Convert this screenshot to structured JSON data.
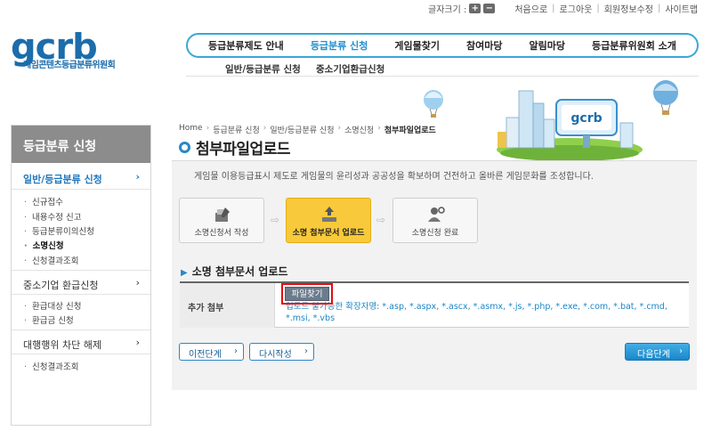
{
  "util": {
    "font_size_label": "글자크기 :",
    "zoom_in": "+",
    "zoom_out": "−",
    "links": [
      "처음으로",
      "로그아웃",
      "회원정보수정",
      "사이트맵"
    ]
  },
  "logo": {
    "text": "gcrb",
    "subtitle": "게임콘텐츠등급분류위원회"
  },
  "gnb": {
    "items": [
      "등급분류제도 안내",
      "등급분류 신청",
      "게임물찾기",
      "참여마당",
      "알림마당",
      "등급분류위원회 소개"
    ],
    "active_index": 1,
    "sub_items": [
      "일반/등급분류 신청",
      "중소기업환급신청"
    ]
  },
  "lnb": {
    "title": "등급분류 신청",
    "groups": [
      {
        "label": "일반/등급분류 신청",
        "arrow": "›",
        "items": [
          "신규접수",
          "내용수정 신고",
          "등급분류이의신청",
          "소명신청",
          "신청결과조회"
        ]
      },
      {
        "label": "중소기업 환급신청",
        "arrow": "›",
        "items": [
          "환급대상 신청",
          "환급금 신청"
        ]
      },
      {
        "label": "대행행위 차단 해제",
        "arrow": "›",
        "items": [
          "신청결과조회"
        ]
      }
    ]
  },
  "breadcrumb": [
    "Home",
    "등급분류 신청",
    "일반/등급분류 신청",
    "소명신청",
    "첨부파일업로드"
  ],
  "page_title": "첨부파일업로드",
  "illustration": {
    "sign_text": "gcrb"
  },
  "description": "게임물 이용등급표시 제도로 게임물의 윤리성과 공공성을 확보하며 건전하고 올바른 게임문화를 조성합니다.",
  "steps": [
    {
      "label": "소명신청서 작성",
      "active": false
    },
    {
      "label": "소명 첨부문서 업로드",
      "active": true
    },
    {
      "label": "소명신청 완료",
      "active": false
    }
  ],
  "section_title": "소명 첨부문서 업로드",
  "form": {
    "field_label": "추가 첨부",
    "upload_button": "파일찾기",
    "ext_note": "업로드 불가능한 확장자명: *.asp, *.aspx, *.ascx, *.asmx, *.js, *.php, *.exe, *.com, *.bat, *.cmd, *.msi, *.vbs"
  },
  "buttons": {
    "prev": "이전단계",
    "rewrite": "다시작성",
    "next": "다음단계",
    "arrow": "›"
  },
  "colors": {
    "accent": "#1f8fd0",
    "step_active": "#f8c93a",
    "highlight": "#e01010"
  }
}
